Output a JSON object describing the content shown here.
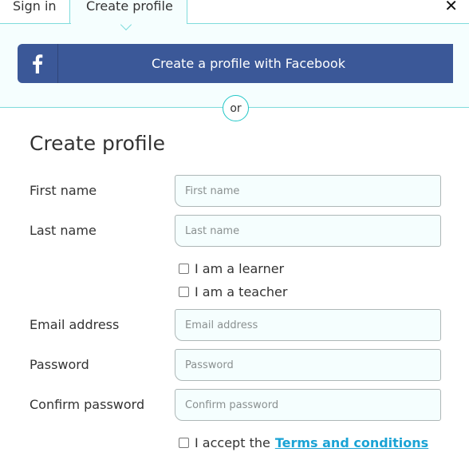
{
  "tabs": [
    {
      "label": "Sign in"
    },
    {
      "label": "Create profile"
    }
  ],
  "close_glyph": "✕",
  "facebook": {
    "label": "Create a profile with Facebook",
    "icon": "facebook-icon",
    "color": "#3b5898"
  },
  "divider_text": "or",
  "form": {
    "title": "Create profile",
    "first_name": {
      "label": "First name",
      "placeholder": "First name",
      "value": ""
    },
    "last_name": {
      "label": "Last name",
      "placeholder": "Last name",
      "value": ""
    },
    "roles": [
      {
        "label": "I am a learner",
        "checked": false
      },
      {
        "label": "I am a teacher",
        "checked": false
      }
    ],
    "email": {
      "label": "Email address",
      "placeholder": "Email address",
      "value": ""
    },
    "password": {
      "label": "Password",
      "placeholder": "Password",
      "value": ""
    },
    "confirm_password": {
      "label": "Confirm password",
      "placeholder": "Confirm password",
      "value": ""
    },
    "accept": {
      "text": "I accept the",
      "link": "Terms and conditions",
      "checked": false
    }
  },
  "colors": {
    "accent": "#22c7c7",
    "link": "#1aa3d5",
    "panel": "#f5fefe"
  }
}
